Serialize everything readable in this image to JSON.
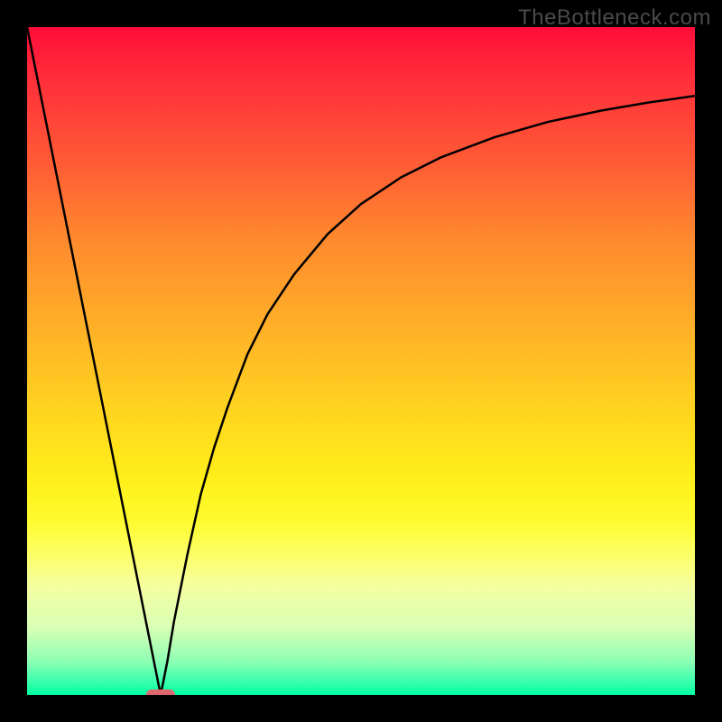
{
  "watermark": {
    "text": "TheBottleneck.com"
  },
  "chart_data": {
    "type": "line",
    "title": "",
    "xlabel": "",
    "ylabel": "",
    "x_range": [
      0,
      100
    ],
    "y_range": [
      0,
      100
    ],
    "grid": false,
    "legend": false,
    "background_gradient": {
      "direction": "vertical",
      "stops": [
        {
          "pos": 0.0,
          "color": "#ff0d3a"
        },
        {
          "pos": 0.5,
          "color": "#ffc020"
        },
        {
          "pos": 0.75,
          "color": "#fffb30"
        },
        {
          "pos": 1.0,
          "color": "#00ffa2"
        }
      ]
    },
    "curve": {
      "description": "V-shaped bottleneck curve: steep linear descent from top-left to a minimum near x≈20, then a decelerating rise approaching an asymptote near the top-right.",
      "x": [
        0,
        4,
        8,
        12,
        16,
        19,
        20,
        21,
        22,
        24,
        26,
        28,
        30,
        33,
        36,
        40,
        45,
        50,
        56,
        62,
        70,
        78,
        86,
        93,
        100
      ],
      "y": [
        100,
        80,
        60,
        40,
        20,
        5,
        0,
        5,
        11,
        21,
        30,
        37,
        43,
        51,
        57,
        63,
        69,
        73.5,
        77.5,
        80.5,
        83.5,
        85.8,
        87.5,
        88.7,
        89.7
      ]
    },
    "marker": {
      "x": 20,
      "y": 0,
      "shape": "rounded-rect",
      "color": "#e06670"
    }
  }
}
